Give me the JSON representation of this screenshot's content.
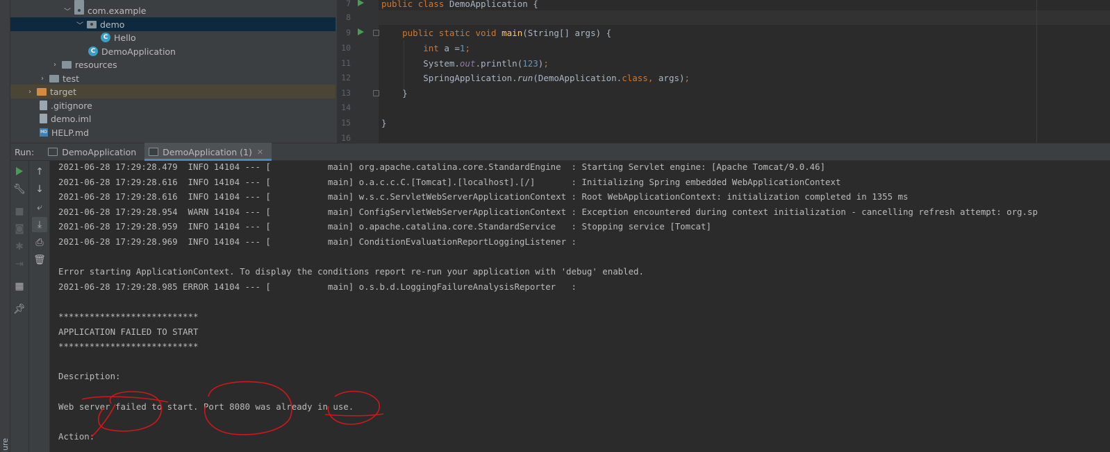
{
  "structure_tab": "ure",
  "project_tree": [
    {
      "label": "com.example",
      "icon": "package-icon",
      "expanded": true
    },
    {
      "label": "demo",
      "icon": "package-icon",
      "expanded": true,
      "selected": true
    },
    {
      "label": "Hello",
      "icon": "class-icon"
    },
    {
      "label": "DemoApplication",
      "icon": "spring-class-icon"
    },
    {
      "label": "resources",
      "icon": "resources-folder-icon",
      "expanded": false
    },
    {
      "label": "test",
      "icon": "folder-icon",
      "expanded": false
    },
    {
      "label": "target",
      "icon": "excluded-folder-icon",
      "expanded": false
    },
    {
      "label": ".gitignore",
      "icon": "file-icon"
    },
    {
      "label": "demo.iml",
      "icon": "module-file-icon"
    },
    {
      "label": "HELP.md",
      "icon": "markdown-file-icon"
    }
  ],
  "editor": {
    "line_numbers": [
      "7",
      "8",
      "9",
      "10",
      "11",
      "12",
      "13",
      "14",
      "15",
      "16"
    ],
    "code": {
      "l7": {
        "kw1": "public",
        "kw2": "class",
        "name": "DemoApplication",
        "rest": " {"
      },
      "l9": {
        "kw1": "public",
        "kw2": "static",
        "kw3": "void",
        "fn": "main",
        "rest": "(String[] args) {"
      },
      "l10": {
        "kw": "int",
        "var": "a",
        "op": " =",
        "num": "1",
        "semi": ";"
      },
      "l11": {
        "pre": "System.",
        "field": "out",
        "mid": ".println(",
        "num": "123",
        "post": ")",
        "semi": ";"
      },
      "l12": {
        "pre": "SpringApplication.",
        "method": "run",
        "mid": "(DemoApplication.",
        "kw": "class",
        "comma": ",",
        "post": " args)",
        "semi": ";"
      },
      "l13": "}",
      "l15": "}"
    }
  },
  "run_panel": {
    "label": "Run:",
    "tabs": [
      {
        "label": "DemoApplication",
        "active": false
      },
      {
        "label": "DemoApplication (1)",
        "active": true
      }
    ]
  },
  "console_lines": [
    "2021-06-28 17:29:28.479  INFO 14104 --- [           main] org.apache.catalina.core.StandardEngine  : Starting Servlet engine: [Apache Tomcat/9.0.46]",
    "2021-06-28 17:29:28.616  INFO 14104 --- [           main] o.a.c.c.C.[Tomcat].[localhost].[/]       : Initializing Spring embedded WebApplicationContext",
    "2021-06-28 17:29:28.616  INFO 14104 --- [           main] w.s.c.ServletWebServerApplicationContext : Root WebApplicationContext: initialization completed in 1355 ms",
    "2021-06-28 17:29:28.954  WARN 14104 --- [           main] ConfigServletWebServerApplicationContext : Exception encountered during context initialization - cancelling refresh attempt: org.sp",
    "2021-06-28 17:29:28.959  INFO 14104 --- [           main] o.apache.catalina.core.StandardService   : Stopping service [Tomcat]",
    "2021-06-28 17:29:28.969  INFO 14104 --- [           main] ConditionEvaluationReportLoggingListener :",
    "",
    "Error starting ApplicationContext. To display the conditions report re-run your application with 'debug' enabled.",
    "2021-06-28 17:29:28.985 ERROR 14104 --- [           main] o.s.b.d.LoggingFailureAnalysisReporter   :",
    "",
    "***************************",
    "APPLICATION FAILED TO START",
    "***************************",
    "",
    "Description:",
    "",
    "Web server failed to start. Port 8080 was already in use.",
    "",
    "Action:"
  ],
  "colors": {
    "keyword": "#cc7832",
    "function": "#ffc66d",
    "number": "#6897bb",
    "field": "#9876aa",
    "text": "#a9b7c6",
    "scribble": "#d0171a"
  }
}
